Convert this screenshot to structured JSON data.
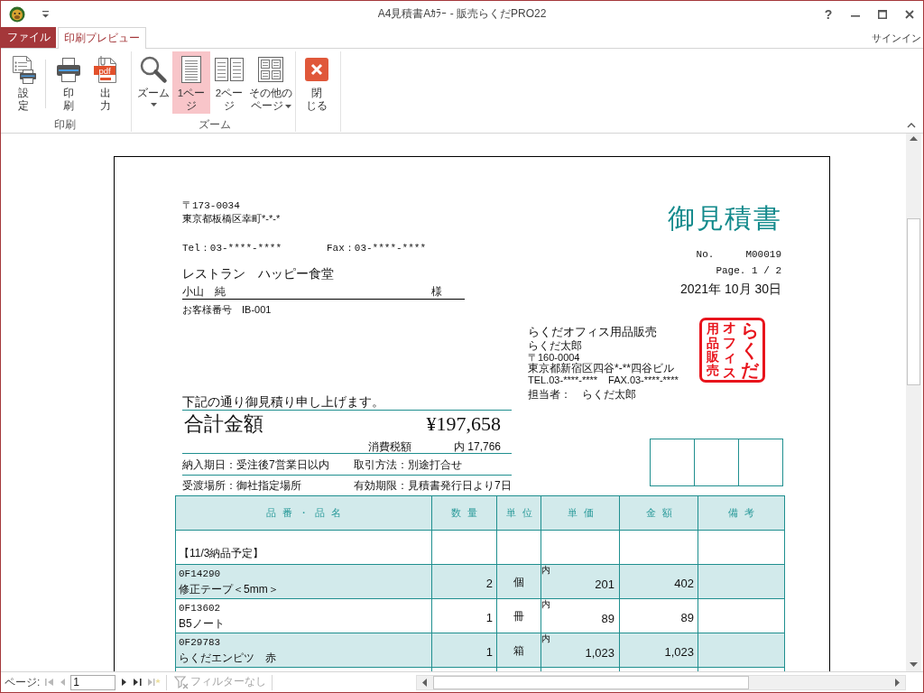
{
  "window": {
    "title": "A4見積書Aｶﾗｰ - 販売らくだPRO22",
    "help_button": "?"
  },
  "tabs": [
    {
      "kind": "file",
      "label": "ファイル",
      "selected": false
    },
    {
      "kind": "tab",
      "label": "印刷プレビュー",
      "selected": true
    }
  ],
  "account": {
    "label": "サインイン"
  },
  "ribbon": {
    "groups": [
      {
        "label": "印刷",
        "buttons": [
          {
            "kind": "setup",
            "label_lines": [
              "設",
              "定"
            ],
            "selected": false,
            "divider_after": true
          },
          {
            "kind": "print",
            "label_lines": [
              "印",
              "刷"
            ],
            "selected": false
          },
          {
            "kind": "pdf",
            "label_lines": [
              "出",
              "力"
            ],
            "badge": "pdf",
            "selected": false
          }
        ]
      },
      {
        "label": "ズーム",
        "buttons": [
          {
            "kind": "zoom",
            "label_lines": [
              "ズーム"
            ],
            "dropdown": true,
            "selected": false
          },
          {
            "kind": "one_page",
            "label_lines": [
              "1ペー",
              "ジ"
            ],
            "selected": true
          },
          {
            "kind": "two_pages",
            "label_lines": [
              "2ペー",
              "ジ"
            ],
            "selected": false
          },
          {
            "kind": "more_pages",
            "label_lines": [
              "その他の",
              "ページ"
            ],
            "dropdown": true,
            "selected": false
          }
        ]
      },
      {
        "buttons": [
          {
            "kind": "close",
            "label_lines": [
              "閉",
              "じる"
            ],
            "selected": false
          }
        ]
      }
    ]
  },
  "document": {
    "customer": {
      "postal_code": "〒173-0034",
      "address": "東京都板橋区幸町*-*-*",
      "phone": "Tel：03-****-****",
      "fax": "Fax：03-****-****",
      "company": "レストラン　ハッピー食堂",
      "contact": "小山　純",
      "honorific": "様",
      "customer_number": "お客様番号　IB-001"
    },
    "title": "御見積書",
    "number_label": "No.",
    "number": "M00019",
    "page": "Page. 1 / 2",
    "date": "2021年 10月 30日",
    "issuer": {
      "company": "らくだオフィス用品販売",
      "person": "らくだ太郎",
      "postal_code": "〒160-0004",
      "address": "東京都新宿区四谷*-**四谷ビル",
      "phone": "TEL.03-****-****",
      "fax": "FAX.03-****-****",
      "staff": "担当者：　らくだ太郎"
    },
    "seal": {
      "columns": [
        "用品販売",
        "オフィス",
        "らくだ"
      ]
    },
    "greeting": "下記の通り御見積り申し上げます。",
    "total": {
      "label": "合計金額",
      "amount": "¥197,658"
    },
    "tax": {
      "label": "消費税額",
      "amount": "内 17,766"
    },
    "terms": [
      {
        "left": "納入期日：受注後7営業日以内",
        "right": "取引方法：別途打合せ"
      },
      {
        "left": "受渡場所：御社指定場所",
        "right": "有効期限：見積書発行日より7日"
      }
    ],
    "table": {
      "columns": [
        "品番・品名",
        "数量",
        "単位",
        "単価",
        "金額",
        "備考"
      ],
      "rows": [
        {
          "kind": "group",
          "label": "【11/3納品予定】"
        },
        {
          "kind": "item",
          "code": "0F14290",
          "name": "修正テープ＜5mm＞",
          "quantity": "2",
          "unit": "個",
          "tax_mark": "内",
          "unit_price": "201",
          "amount": "402"
        },
        {
          "kind": "item",
          "code": "0F13602",
          "name": "B5ノート",
          "quantity": "1",
          "unit": "冊",
          "tax_mark": "内",
          "unit_price": "89",
          "amount": "89"
        },
        {
          "kind": "item",
          "code": "0F29783",
          "name": "らくだエンピツ　赤",
          "quantity": "1",
          "unit": "箱",
          "tax_mark": "内",
          "unit_price": "1,023",
          "amount": "1,023"
        }
      ]
    }
  },
  "status_bar": {
    "page_label": "ページ:",
    "page_value": "1",
    "nav_before": [
      {
        "kind": "first",
        "disabled": true
      },
      {
        "kind": "previous",
        "disabled": true
      }
    ],
    "nav_after": [
      {
        "kind": "next",
        "disabled": false
      },
      {
        "kind": "last",
        "disabled": false
      },
      {
        "kind": "new",
        "disabled": true
      }
    ],
    "filter": {
      "label": "フィルターなし",
      "disabled": true
    }
  }
}
